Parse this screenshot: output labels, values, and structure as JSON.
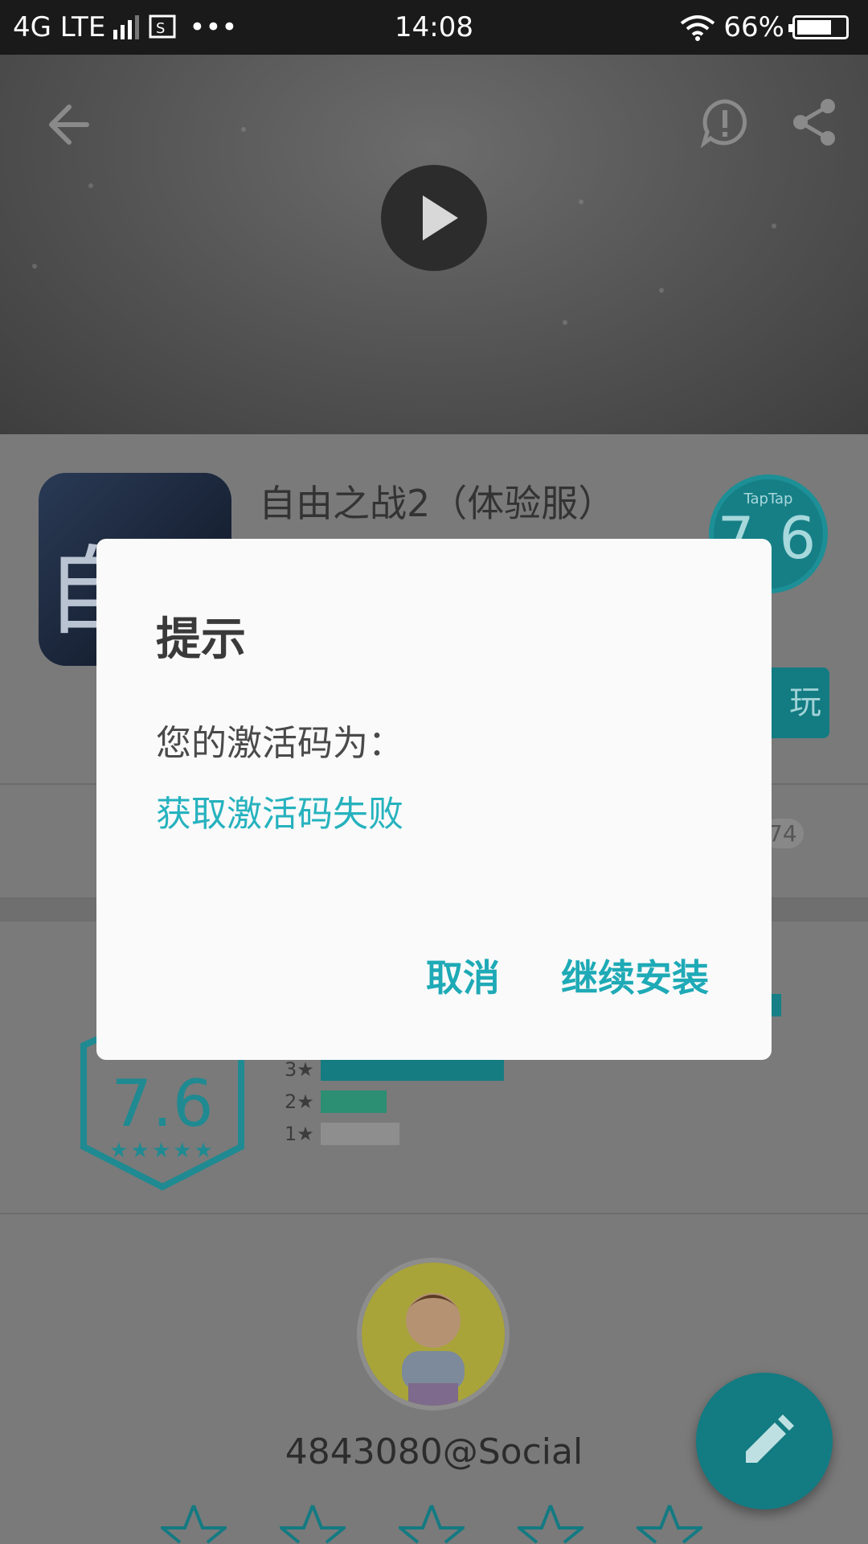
{
  "status_bar": {
    "network": "4G LTE",
    "time": "14:08",
    "battery": "66%"
  },
  "hero": {
    "icons": [
      "back-arrow-icon",
      "report-icon",
      "share-icon",
      "play-icon"
    ]
  },
  "app": {
    "title": "自由之战2（体验服）",
    "score_brand": "TapTap",
    "score": "7.6",
    "play_button_partial": "玩",
    "rating_count_partial": "74",
    "icon_glyph": "自"
  },
  "ratings": {
    "score": "7.6",
    "stars": "★★★★★",
    "levels": [
      {
        "label": "3★",
        "fraction": 0.4
      },
      {
        "label": "2★",
        "fraction": 0.14
      },
      {
        "label": "1★",
        "fraction": 0.17
      }
    ]
  },
  "reviewer": {
    "name": "4843080@Social",
    "star_count": 5
  },
  "dialog": {
    "title": "提示",
    "message": "您的激活码为：",
    "status": "获取激活码失败",
    "cancel_label": "取消",
    "continue_label": "继续安装"
  },
  "colors": {
    "accent": "#1eaab6",
    "teal_dim": "#137b82",
    "overlay_bg": "#7a7a7a"
  }
}
